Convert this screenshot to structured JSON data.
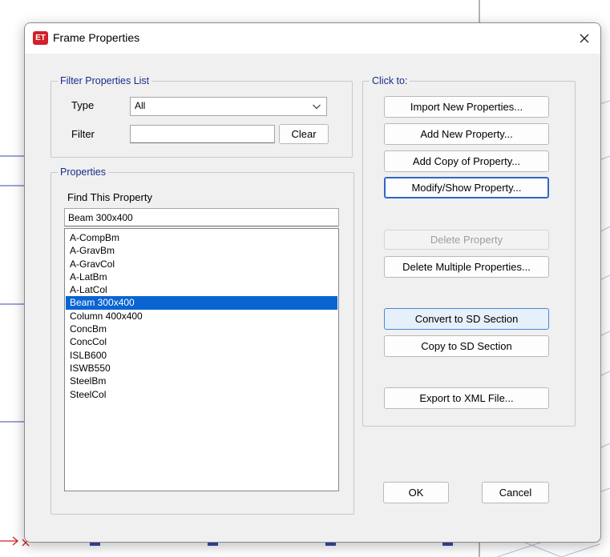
{
  "window": {
    "app_icon_text": "ET",
    "title": "Frame Properties"
  },
  "filter_group": {
    "caption": "Filter Properties List",
    "type_label": "Type",
    "type_value": "All",
    "filter_label": "Filter",
    "filter_value": "",
    "clear_label": "Clear"
  },
  "properties_group": {
    "caption": "Properties",
    "find_label": "Find This Property",
    "find_value": "Beam 300x400",
    "items": [
      {
        "label": "A-CompBm",
        "selected": false
      },
      {
        "label": "A-GravBm",
        "selected": false
      },
      {
        "label": "A-GravCol",
        "selected": false
      },
      {
        "label": "A-LatBm",
        "selected": false
      },
      {
        "label": "A-LatCol",
        "selected": false
      },
      {
        "label": "Beam 300x400",
        "selected": true
      },
      {
        "label": "Column 400x400",
        "selected": false
      },
      {
        "label": "ConcBm",
        "selected": false
      },
      {
        "label": "ConcCol",
        "selected": false
      },
      {
        "label": "ISLB600",
        "selected": false
      },
      {
        "label": "ISWB550",
        "selected": false
      },
      {
        "label": "SteelBm",
        "selected": false
      },
      {
        "label": "SteelCol",
        "selected": false
      }
    ]
  },
  "click_group": {
    "caption": "Click to:",
    "import_label": "Import New Properties...",
    "add_new_label": "Add New Property...",
    "add_copy_label": "Add Copy of Property...",
    "modify_label": "Modify/Show Property...",
    "delete_label": "Delete Property",
    "delete_multiple_label": "Delete Multiple Properties...",
    "convert_label": "Convert to SD Section",
    "copy_sd_label": "Copy to SD Section",
    "export_label": "Export to XML File..."
  },
  "footer": {
    "ok_label": "OK",
    "cancel_label": "Cancel"
  },
  "colors": {
    "caption_blue": "#1a2c8a",
    "selection_blue": "#0a64d2",
    "app_icon_red": "#d1202a",
    "drawing_line_blue": "#3a4aa8"
  }
}
